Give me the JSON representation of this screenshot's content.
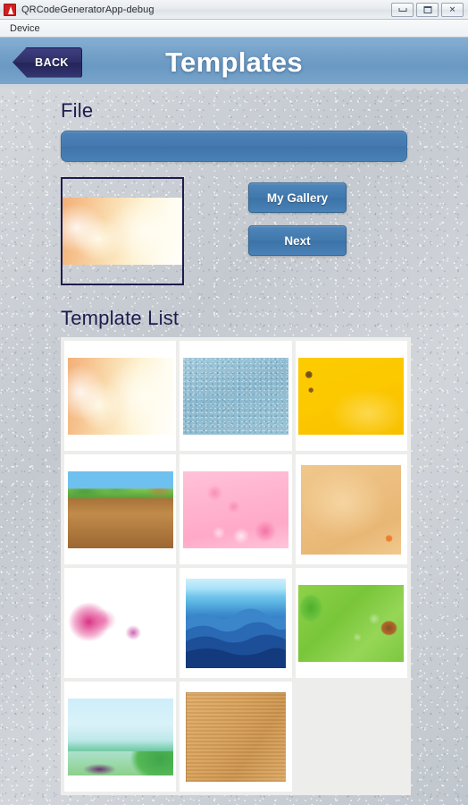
{
  "window": {
    "title": "QRCodeGeneratorApp-debug",
    "app_icon": "android-emulator-icon",
    "controls": {
      "minimize": "minimize-icon",
      "maximize": "maximize-icon",
      "close": "✕"
    },
    "menu": [
      "Device"
    ]
  },
  "appbar": {
    "back_label": "BACK",
    "title": "Templates"
  },
  "file_section": {
    "label": "File",
    "field_value": "",
    "field_placeholder": ""
  },
  "preview": {
    "name": "selected-template-preview",
    "art": "art-peach"
  },
  "buttons": {
    "my_gallery": "My Gallery",
    "next": "Next"
  },
  "template_list": {
    "label": "Template List",
    "items": [
      {
        "name": "peach-floral",
        "art": "art-peach",
        "shape": "wide"
      },
      {
        "name": "blue-denim-texture",
        "art": "art-denim",
        "shape": "wide"
      },
      {
        "name": "yellow-sunflower",
        "art": "art-yellow",
        "shape": "wide"
      },
      {
        "name": "cartoon-forest-scene",
        "art": "art-forest",
        "shape": "wide"
      },
      {
        "name": "pink-cherry-blossom",
        "art": "art-pink",
        "shape": "wide"
      },
      {
        "name": "tan-persimmon",
        "art": "art-tan",
        "shape": "tall"
      },
      {
        "name": "pink-feather",
        "art": "art-feather",
        "shape": "wide"
      },
      {
        "name": "blue-mountain-layers",
        "art": "art-mountain",
        "shape": "tall"
      },
      {
        "name": "green-hummingbird",
        "art": "art-green",
        "shape": "wide"
      },
      {
        "name": "seaside-meadow",
        "art": "art-seaside",
        "shape": "wide"
      },
      {
        "name": "wooden-planks",
        "art": "art-wood",
        "shape": "tall"
      },
      {
        "name": "empty-slot",
        "art": "",
        "shape": "empty"
      }
    ]
  },
  "colors": {
    "appbar_blue": "#6f9dc6",
    "button_blue": "#4079ad",
    "back_navy": "#2e2f66",
    "heading_navy": "#1d1d4e",
    "panel_gray": "#ededeb",
    "background_gray": "#c6cbd2"
  }
}
